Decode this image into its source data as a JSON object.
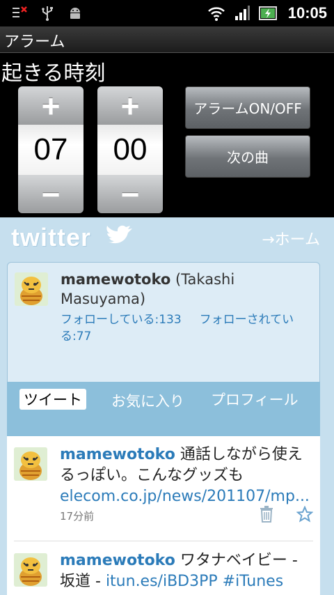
{
  "status_bar": {
    "time": "10:05",
    "icons": [
      "settings-notification-icon",
      "usb-icon",
      "android-debug-icon",
      "wifi-icon",
      "signal-icon",
      "battery-charging-icon"
    ]
  },
  "app": {
    "title": "アラーム"
  },
  "alarm": {
    "label": "起きる時刻",
    "hour": "07",
    "minute": "00",
    "plus": "+",
    "minus": "−",
    "toggle_label": "アラームON/OFF",
    "next_song_label": "次の曲"
  },
  "twitter": {
    "logo": "twitter",
    "home_link": "→ホーム",
    "profile": {
      "username": "mamewotoko",
      "fullname": "(Takashi Masuyama)",
      "following": "フォローしている:133",
      "followers": "フォローされている:77"
    },
    "tabs": [
      "ツイート",
      "お気に入り",
      "プロフィール"
    ],
    "tweets": [
      {
        "user": "mamewotoko",
        "text": " 通話しながら使えるっぽい。こんなグッズも ",
        "link": "elecom.co.jp/news/201107/mp...",
        "time": "17分前"
      },
      {
        "user": "mamewotoko",
        "text": " ワタナベイビー - 坂道 - ",
        "link": "itun.es/iBD3PP #iTunes",
        "time": ""
      }
    ]
  },
  "colors": {
    "twitter_link": "#2b7bb9",
    "twitter_bg": "#c6dfee",
    "tab_bar": "#8cbfdb"
  }
}
